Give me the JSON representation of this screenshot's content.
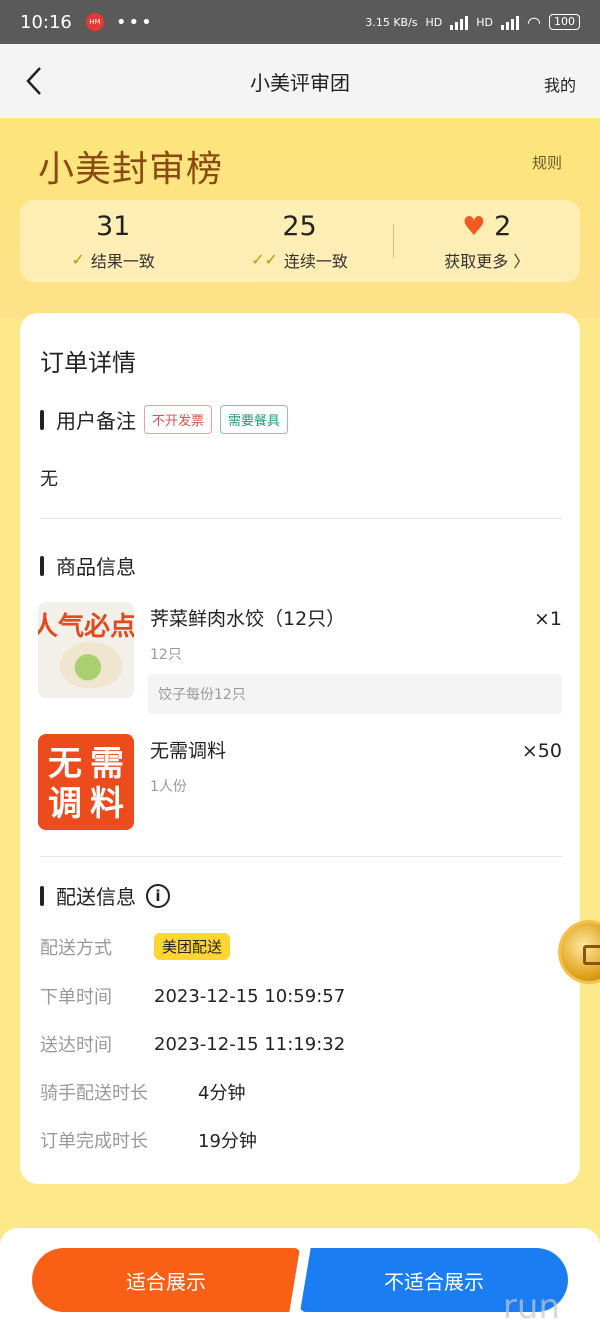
{
  "status_bar": {
    "time": "10:16",
    "app_badge": "HM",
    "more": "•••",
    "speed": "3.15 KB/s",
    "hd1": "HD",
    "hd2": "HD",
    "battery": "100"
  },
  "nav": {
    "title": "小美评审团",
    "mine": "我的"
  },
  "hero": {
    "brand": "小美封审榜",
    "rules": "规则",
    "stats": [
      {
        "value": "31",
        "label": "结果一致"
      },
      {
        "value": "25",
        "label": "连续一致"
      },
      {
        "value": "2",
        "label": "获取更多 〉"
      }
    ]
  },
  "order": {
    "title": "订单详情",
    "remark_title": "用户备注",
    "tags": [
      "不开发票",
      "需要餐具"
    ],
    "remark": "无",
    "goods_title": "商品信息",
    "goods": [
      {
        "thumb_text": "人气必点",
        "name": "荠菜鲜肉水饺（12只）",
        "spec": "12只",
        "qty": "×1",
        "note": "饺子每份12只"
      },
      {
        "thumb_text": [
          "无",
          "需",
          "调",
          "料"
        ],
        "name": "无需调料",
        "spec": "1人份",
        "qty": "×50"
      }
    ],
    "delivery_title": "配送信息",
    "delivery": {
      "method_label": "配送方式",
      "method_value": "美团配送",
      "order_time_label": "下单时间",
      "order_time": "2023-12-15 10:59:57",
      "arrive_time_label": "送达时间",
      "arrive_time": "2023-12-15 11:19:32",
      "rider_label": "骑手配送时长",
      "rider_value": "4分钟",
      "complete_label": "订单完成时长",
      "complete_value": "19分钟"
    }
  },
  "footer": {
    "ok": "适合展示",
    "no": "不适合展示",
    "watermark": "run"
  },
  "colors": {
    "accent_orange": "#fa5f16",
    "accent_blue": "#1a7df2",
    "hero_yellow": "#fde57a",
    "brand_brown": "#8a4a12"
  }
}
